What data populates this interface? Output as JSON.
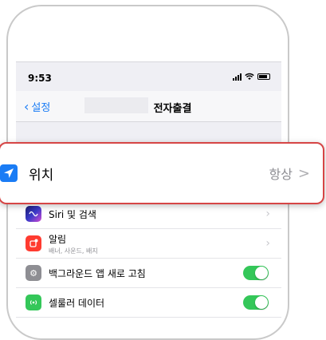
{
  "status_bar": {
    "time": "9:53"
  },
  "nav": {
    "back_label": "설정",
    "title": "전자출결"
  },
  "highlight": {
    "label": "위치",
    "value": "항상",
    "chevron": ">"
  },
  "rows": [
    {
      "label": "Siri 및 검색",
      "sub": "",
      "icon": "siri-icon",
      "control": "chevron"
    },
    {
      "label": "알림",
      "sub": "배너, 사운드, 배지",
      "icon": "notification-icon",
      "control": "chevron"
    },
    {
      "label": "백그라운드 앱 새로 고침",
      "sub": "",
      "icon": "gear-icon",
      "control": "toggle-on"
    },
    {
      "label": "셀룰러 데이터",
      "sub": "",
      "icon": "antenna-icon",
      "control": "toggle-on"
    }
  ],
  "colors": {
    "accent": "#1a7cf5",
    "toggle_on": "#34c759",
    "highlight_border": "#d64545"
  }
}
